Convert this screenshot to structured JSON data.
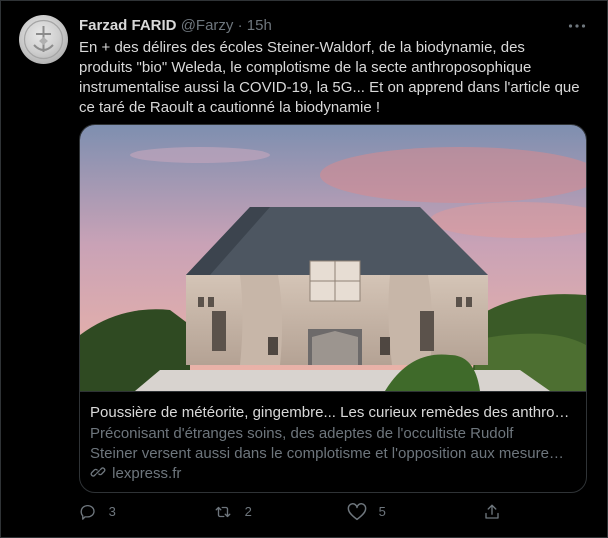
{
  "tweet": {
    "author_name": "Farzad FARID",
    "handle": "@Farzy",
    "separator": "·",
    "time": "15h",
    "text": "En + des délires des écoles Steiner-Waldorf, de la biodynamie, des\nproduits \"bio\" Weleda, le complotisme de la secte anthroposophique\ninstrumentalise aussi la COVID-19, la 5G... Et on apprend dans l'article que\nce taré de Raoult a cautionné la biodynamie !"
  },
  "card": {
    "title": "Poussière de météorite, gingembre... Les curieux remèdes des anthro…",
    "description": "Préconisant d'étranges soins, des adeptes de l'occultiste Rudolf\nSteiner versent aussi dans le complotisme et l'opposition aux mesure…",
    "domain": "lexpress.fr"
  },
  "actions": {
    "reply_count": "3",
    "retweet_count": "2",
    "like_count": "5"
  },
  "icons": [
    "avatar-image",
    "more-icon",
    "link-icon",
    "reply-icon",
    "retweet-icon",
    "like-icon",
    "share-icon"
  ],
  "colors": {
    "background": "#000000",
    "text": "#d9d9d9",
    "secondary": "#6e767d",
    "border": "#2f3336"
  }
}
